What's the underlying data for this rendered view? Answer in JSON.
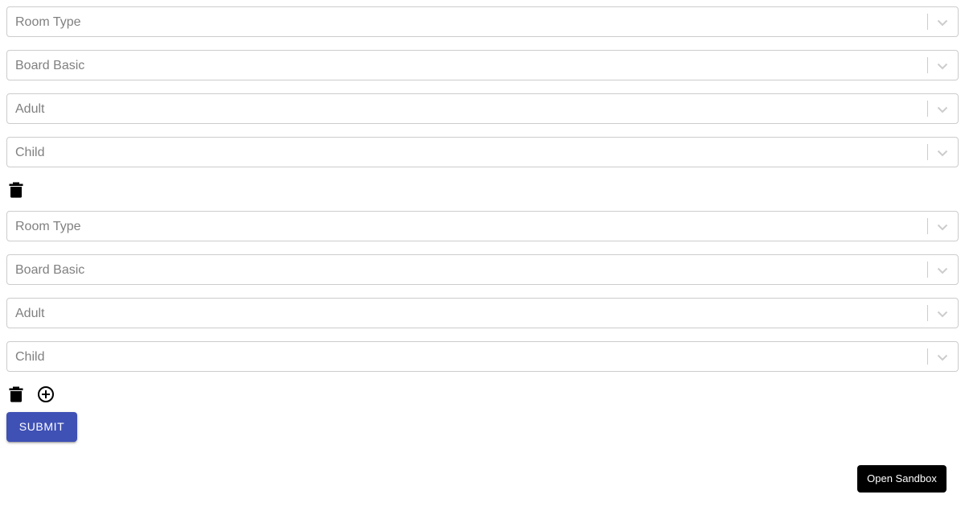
{
  "rooms": [
    {
      "selects": {
        "room_type": "Room Type",
        "board": "Board Basic",
        "adult": "Adult",
        "child": "Child"
      },
      "actions": [
        "delete-icon"
      ]
    },
    {
      "selects": {
        "room_type": "Room Type",
        "board": "Board Basic",
        "adult": "Adult",
        "child": "Child"
      },
      "actions": [
        "delete-icon",
        "add-circle-icon"
      ]
    }
  ],
  "submit_label": "SUBMIT",
  "sandbox_label": "Open Sandbox",
  "colors": {
    "primary": "#3f51b5",
    "border": "#cccccc",
    "placeholder": "#808080",
    "sandbox_bg": "#000000"
  }
}
